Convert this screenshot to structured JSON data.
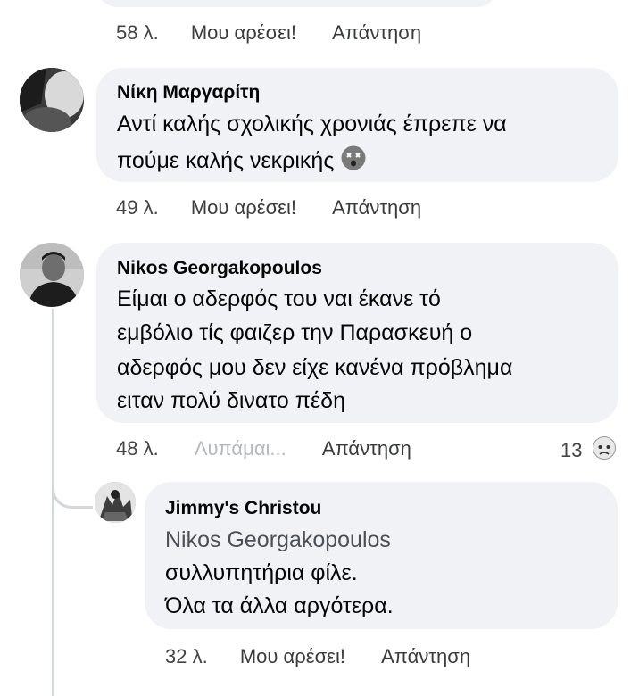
{
  "top_meta": {
    "time": "58 λ.",
    "like": "Μου αρέσει!",
    "reply": "Απάντηση"
  },
  "comments": [
    {
      "author": "Νίκη Μαργαρίτη",
      "lines": [
        "Αντί καλής σχολικής χρονιάς έπρεπε να",
        "πούμε καλής νεκρικής"
      ],
      "emoji_icon": "dizzy-face-emoji",
      "time": "49 λ.",
      "like": "Μου αρέσει!",
      "reply": "Απάντηση"
    },
    {
      "author": "Nikos Georgakopoulos",
      "lines": [
        "Είμαι ο αδερφός του ναι έκανε τό",
        "εμβόλιο τίς φαιζερ την Παρασκευή ο",
        "αδερφός μου δεν είχε κανένα πρόβλημα",
        "ειταν πολύ δινατο πέδη"
      ],
      "time": "48 λ.",
      "like": "Λυπάμαι...",
      "reply": "Απάντηση",
      "reaction_count": "13",
      "reaction_icon": "sad-reaction-icon"
    },
    {
      "author": "Jimmy's Christou",
      "reply_to": "Nikos Georgakopoulos",
      "lines": [
        "συλλυπητήρια φίλε.",
        "Όλα τα άλλα αργότερα."
      ],
      "time": "32 λ.",
      "like": "Μου αρέσει!",
      "reply": "Απάντηση"
    }
  ]
}
